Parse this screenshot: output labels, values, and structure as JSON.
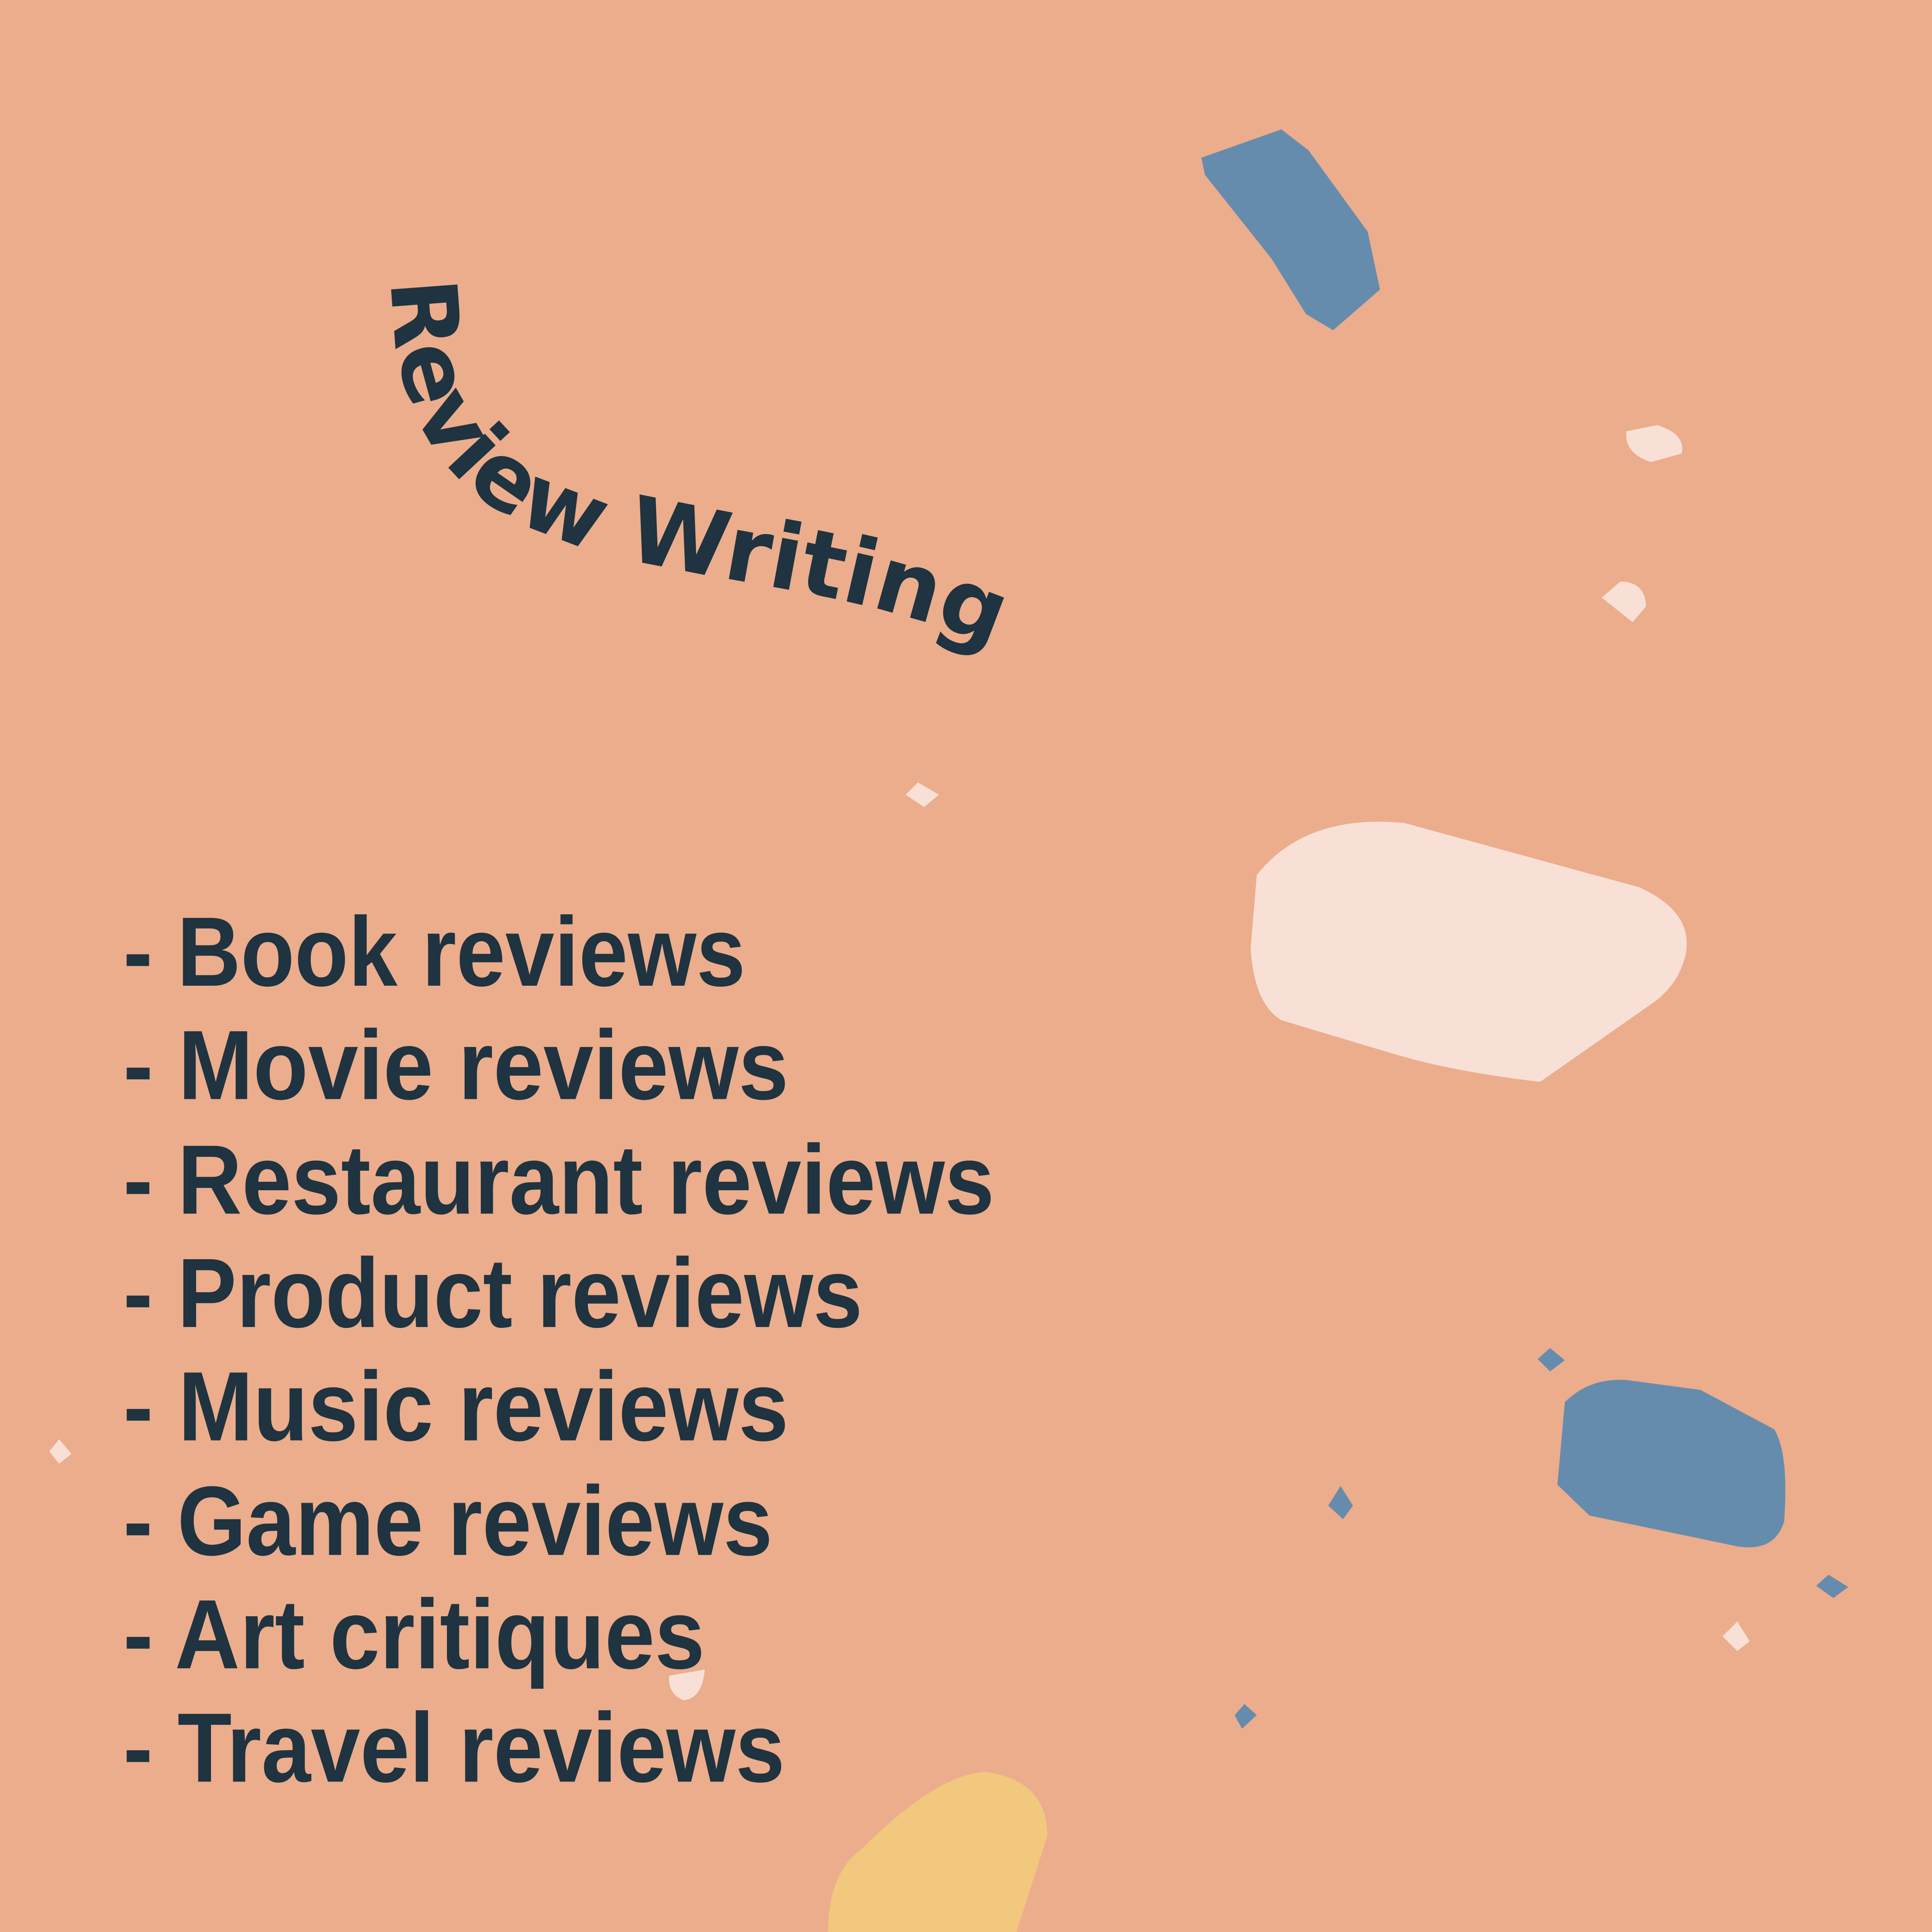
{
  "title": "Review Writing",
  "items": [
    "- Book reviews",
    "- Movie reviews",
    "- Restaurant reviews",
    "- Product reviews",
    "- Music reviews",
    "- Game reviews",
    "- Art critiques",
    "- Travel reviews"
  ],
  "colors": {
    "background": "#EBAD8C",
    "text": "#1F3340",
    "blue": "#668CAD",
    "light_pink": "#F9E0D6",
    "yellow": "#F2C77E"
  }
}
